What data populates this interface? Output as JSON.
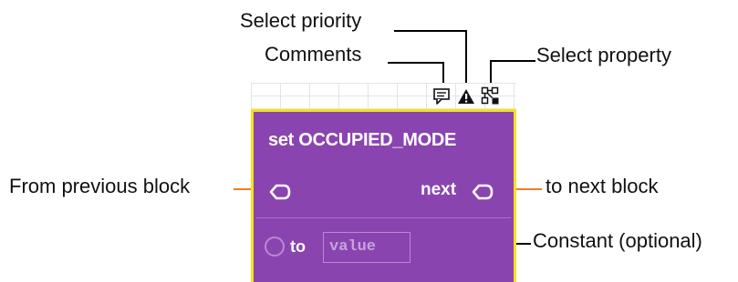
{
  "labels": {
    "select_priority": "Select priority",
    "comments": "Comments",
    "select_property": "Select property",
    "from_previous_block": "From previous block",
    "to_next_block": "to next block",
    "constant_optional": "Constant (optional)"
  },
  "block": {
    "title": "set OCCUPIED_MODE",
    "next_label": "next",
    "to_label": "to",
    "value_placeholder": "value"
  },
  "colors": {
    "block_fill": "#8a44b0",
    "block_border": "#f4e21c",
    "callout_line_orange": "#f07c2a",
    "callout_line_black": "#000000"
  },
  "icons": [
    "comment-icon",
    "warning-icon",
    "property-icon"
  ]
}
